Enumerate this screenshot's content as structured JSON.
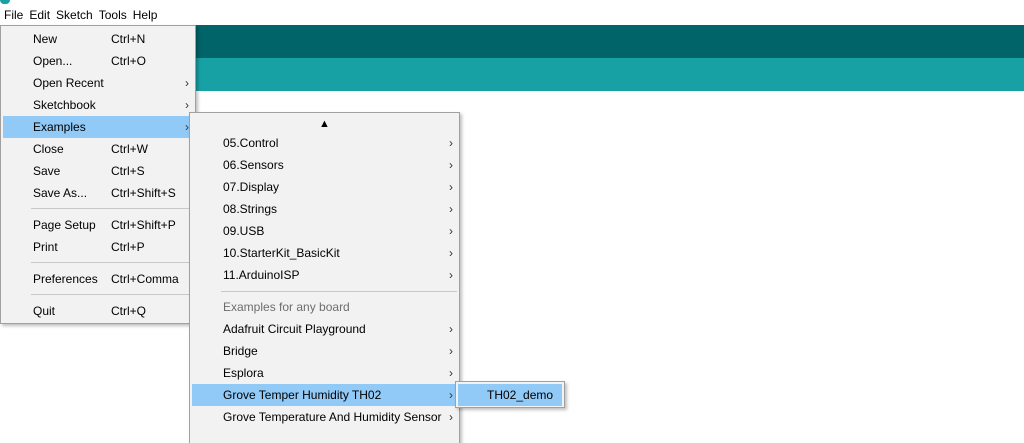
{
  "menubar": {
    "items": [
      "File",
      "Edit",
      "Sketch",
      "Tools",
      "Help"
    ]
  },
  "colors": {
    "toolbar": "#006468",
    "tabbar": "#17a1a5",
    "menu_bg": "#f2f2f2",
    "highlight": "#91c9f7"
  },
  "file_menu": {
    "items": [
      {
        "label": "New",
        "shortcut": "Ctrl+N"
      },
      {
        "label": "Open...",
        "shortcut": "Ctrl+O"
      },
      {
        "label": "Open Recent",
        "shortcut": "",
        "submenu": true
      },
      {
        "label": "Sketchbook",
        "shortcut": "",
        "submenu": true
      },
      {
        "label": "Examples",
        "shortcut": "",
        "submenu": true,
        "highlighted": true
      },
      {
        "label": "Close",
        "shortcut": "Ctrl+W"
      },
      {
        "label": "Save",
        "shortcut": "Ctrl+S"
      },
      {
        "label": "Save As...",
        "shortcut": "Ctrl+Shift+S"
      },
      {
        "label": "Page Setup",
        "shortcut": "Ctrl+Shift+P"
      },
      {
        "label": "Print",
        "shortcut": "Ctrl+P"
      },
      {
        "label": "Preferences",
        "shortcut": "Ctrl+Comma"
      },
      {
        "label": "Quit",
        "shortcut": "Ctrl+Q"
      }
    ]
  },
  "examples_menu": {
    "scroll_up_glyph": "▲",
    "items": [
      {
        "label": "05.Control",
        "submenu": true
      },
      {
        "label": "06.Sensors",
        "submenu": true
      },
      {
        "label": "07.Display",
        "submenu": true
      },
      {
        "label": "08.Strings",
        "submenu": true
      },
      {
        "label": "09.USB",
        "submenu": true
      },
      {
        "label": "10.StarterKit_BasicKit",
        "submenu": true
      },
      {
        "label": "11.ArduinoISP",
        "submenu": true
      }
    ],
    "section_header": "Examples for any board",
    "board_items": [
      {
        "label": "Adafruit Circuit Playground",
        "submenu": true
      },
      {
        "label": "Bridge",
        "submenu": true
      },
      {
        "label": "Esplora",
        "submenu": true
      },
      {
        "label": "Grove Temper Humidity TH02",
        "submenu": true,
        "highlighted": true
      },
      {
        "label": "Grove Temperature And Humidity Sensor",
        "submenu": true
      }
    ]
  },
  "grove_submenu": {
    "items": [
      {
        "label": "TH02_demo",
        "highlighted": true
      }
    ]
  },
  "arrow_glyph": "›"
}
